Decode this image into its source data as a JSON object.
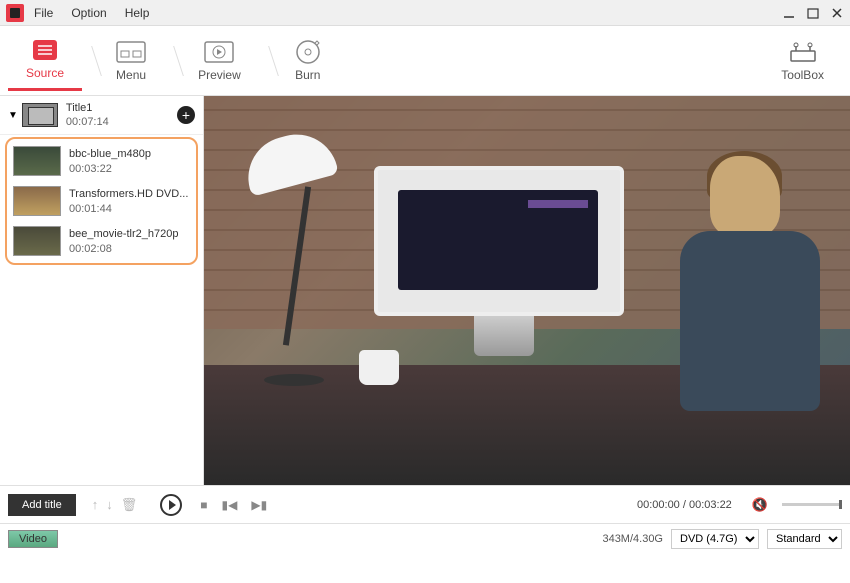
{
  "menu": {
    "file": "File",
    "option": "Option",
    "help": "Help"
  },
  "tabs": {
    "source": "Source",
    "menu": "Menu",
    "preview": "Preview",
    "burn": "Burn",
    "toolbox": "ToolBox"
  },
  "title": {
    "name": "Title1",
    "duration": "00:07:14"
  },
  "clips": [
    {
      "name": "bbc-blue_m480p",
      "duration": "00:03:22"
    },
    {
      "name": "Transformers.HD DVD...",
      "duration": "00:01:44"
    },
    {
      "name": "bee_movie-tlr2_h720p",
      "duration": "00:02:08"
    }
  ],
  "controls": {
    "add_title": "Add title",
    "time_current": "00:00:00",
    "time_total": "00:03:22"
  },
  "timeline": {
    "video_label": "Video",
    "size_info": "343M/4.30G",
    "disc_type": "DVD (4.7G)",
    "quality": "Standard"
  }
}
